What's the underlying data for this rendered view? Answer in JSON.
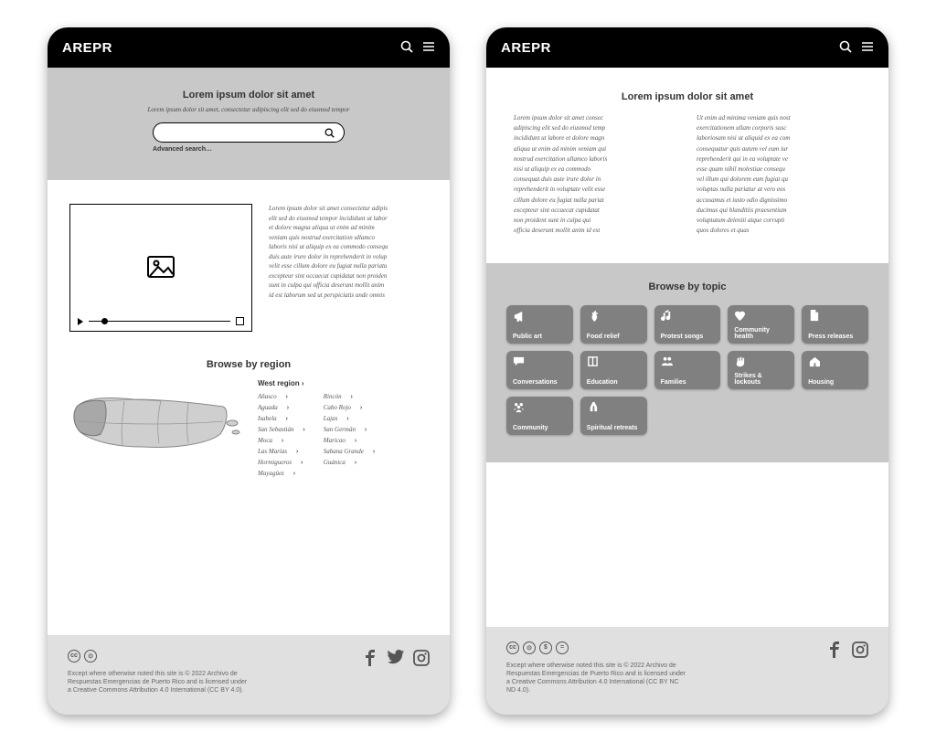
{
  "brand": "AREPR",
  "screen1": {
    "hero": {
      "title": "Lorem ipsum dolor sit amet",
      "subtitle": "Lorem ipsum dolor sit amet, consectetur adipiscing elit sed do eiusmod tempor",
      "advanced": "Advanced search…"
    },
    "media_text": [
      "Lorem ipsum dolor sit amet consectetur adipis",
      "elit sed do eiusmod tempor incididunt ut labor",
      "et dolore magna aliqua ut enim ad minim",
      "veniam quis nostrud exercitation ullamco",
      "laboris nisi ut aliquip ex ea commodo consequ",
      "duis aute irure dolor in reprehenderit in volup",
      "velit esse cillum dolore eu fugiat nulla pariatu",
      "excepteur sint occaecat cupidatat non proiden",
      "sunt in culpa qui officia deserunt mollit anim",
      "id est laborum sed ut perspiciatis unde omnis"
    ],
    "region": {
      "heading": "Browse by region",
      "selected": "West region",
      "col1": [
        "Añasco",
        "Aguada",
        "Isabela",
        "San Sebastián",
        "Moca",
        "Las Marías",
        "Hormigueros",
        "Mayagüez"
      ],
      "col2": [
        "Rincón",
        "Cabo Rojo",
        "Lajas",
        "San Germán",
        "Maricao",
        "Sabana Grande",
        "Guánica"
      ]
    },
    "footer": {
      "cc": [
        "cc",
        "⊙"
      ],
      "text": "Except where otherwise noted this site is © 2022 Archivo de Respuestas Emergencias de Puerto Rico and is licensed under a Creative Commons Attribution 4.0 International (CC BY 4.0)."
    }
  },
  "screen2": {
    "intro": {
      "title": "Lorem ipsum dolor sit amet",
      "col1": [
        "Lorem ipsum dolor sit amet consec",
        "adipiscing elit sed do eiusmod temp",
        "incididunt ut labore et dolore magn",
        "aliqua ut enim ad minim veniam qui",
        "nostrud exercitation ullamco laboris",
        "nisi ut aliquip ex ea commodo",
        "consequat duis aute irure dolor in",
        "reprehenderit in voluptate velit esse",
        "cillum dolore eu fugiat nulla pariat",
        "excepteur sint occaecat cupidatat",
        "non proident sunt in culpa qui",
        "officia deserunt mollit anim id est"
      ],
      "col2": [
        "Ut enim ad minima veniam quis nost",
        "exercitationem ullam corporis susc",
        "laboriosam nisi ut aliquid ex ea com",
        "consequatur quis autem vel eum iur",
        "reprehenderit qui in ea voluptate ve",
        "esse quam nihil molestiae consequ",
        "vel illum qui dolorem eum fugiat qu",
        "voluptas nulla pariatur at vero eos",
        "accusamus et iusto odio dignissimo",
        "ducimus qui blanditiis praesentium",
        "voluptatum deleniti atque corrupti",
        "quos dolores et quas"
      ]
    },
    "topics": {
      "heading": "Browse by topic",
      "items": [
        {
          "label": "Public art",
          "icon": "megaphone"
        },
        {
          "label": "Food relief",
          "icon": "carrot"
        },
        {
          "label": "Protest songs",
          "icon": "music"
        },
        {
          "label": "Community health",
          "icon": "heart"
        },
        {
          "label": "Press releases",
          "icon": "doc"
        },
        {
          "label": "Conversations",
          "icon": "chat"
        },
        {
          "label": "Education",
          "icon": "book"
        },
        {
          "label": "Families",
          "icon": "people"
        },
        {
          "label": "Strikes & lockouts",
          "icon": "fist"
        },
        {
          "label": "Housing",
          "icon": "home"
        },
        {
          "label": "Community",
          "icon": "group"
        },
        {
          "label": "Spiritual retreats",
          "icon": "pray"
        }
      ]
    },
    "footer": {
      "cc": [
        "cc",
        "⊙",
        "$",
        "="
      ],
      "text": "Except where otherwise noted this site is © 2022 Archivo de Respuestas Emergencias de Puerto Rico and is licensed under a Creative Commons Attribution 4.0 International (CC BY NC ND 4.0)."
    }
  }
}
